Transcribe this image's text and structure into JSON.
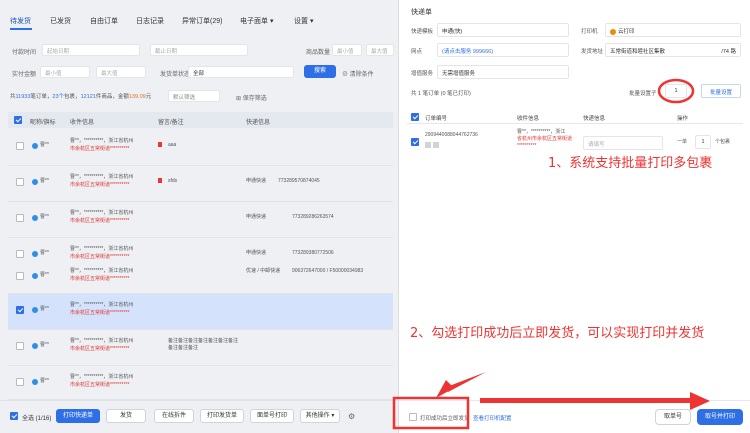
{
  "tabs": [
    "待发货",
    "已发货",
    "自由订单",
    "日志记录",
    "异常订单(29)",
    "电子面单 ▾",
    "设置 ▾"
  ],
  "filters": {
    "row1": [
      {
        "label": "付款时间",
        "ph": "起始日期"
      },
      {
        "label": "",
        "ph": "截止日期"
      },
      {
        "label": "商品数量",
        "ph": "最小值"
      },
      {
        "label": "",
        "ph": "最大值"
      }
    ],
    "row2": [
      {
        "label": "实付金额",
        "ph": "最小值"
      },
      {
        "label": "",
        "ph": "最大值"
      },
      {
        "label": "发货单状态",
        "ph": "全部"
      }
    ],
    "search": "搜索",
    "clear": "⊘ 清除条件"
  },
  "summary": {
    "prefix": "共",
    "orders": "11933",
    "t1": "笔订单，",
    "packages": "23个",
    "t2": "包裹，",
    "items": "12121",
    "t3": "件商品，金额",
    "amount": "139.09",
    "unit": "元",
    "tag": "默认筛选",
    "save": "保存筛选"
  },
  "table": {
    "headers": [
      "昵称/旗标",
      "收件信息",
      "留言/备注",
      "快递信息"
    ]
  },
  "rows": [
    {
      "nick": "曹**",
      "addr1": "曹**，**********，浙江省杭州",
      "addr2": "市余杭区五常街道**********",
      "note": "aaa",
      "express": "",
      "tracking": ""
    },
    {
      "nick": "曹**",
      "addr1": "曹**，**********，浙江省杭州",
      "addr2": "市余杭区五常街道**********",
      "note": "sfds",
      "express": "申通快递",
      "tracking": "773289570874045"
    },
    {
      "nick": "曹**",
      "addr1": "曹**，**********，浙江省杭州",
      "addr2": "市余杭区五常街道**********",
      "note": "",
      "express": "申通快递",
      "tracking": "773289286263574"
    },
    {
      "nick": "曹**",
      "addr1": "曹**，**********，浙江省杭州",
      "addr2": "市余杭区五常街道**********",
      "note": "",
      "express": "申通快递",
      "tracking": "773289380772506"
    },
    {
      "nick": "曹**",
      "addr1": "曹**，**********，浙江省杭州",
      "addr2": "市余杭区五常街道**********",
      "note": "",
      "express": "优速 / 中邮快递",
      "tracking": "906372647000 / F50000034983"
    },
    {
      "nick": "曹**",
      "addr1": "曹**，**********，浙江省杭州",
      "addr2": "市余杭区五常街道**********",
      "note": "",
      "express": "",
      "tracking": ""
    },
    {
      "nick": "曹**",
      "addr1": "曹**，**********，浙江省杭州",
      "addr2": "市余杭区五常街道**********",
      "note": "备注备注备注备注备注备注备注备注备注备注",
      "express": "",
      "tracking": ""
    },
    {
      "nick": "曹**",
      "addr1": "曹**，**********，浙江省杭州",
      "addr2": "市余杭区五常街道**********",
      "note": "",
      "express": "",
      "tracking": ""
    }
  ],
  "bottom": {
    "selectall": "全选 (1/16)",
    "buttons": [
      "打印快递单",
      "发货",
      "在线拆件",
      "打印发货单",
      "面单号打印",
      "其他操作 ▾"
    ]
  },
  "panel": {
    "title": "快递单",
    "r1": {
      "l1": "快递模板",
      "v1": "申通(快)",
      "l2": "打印机",
      "v2": "云打印"
    },
    "r2": {
      "l1": "网点",
      "v1": "(请点击服务 999666)",
      "l2": "发货地址",
      "v2": "五常街道和睦社区集散",
      "v2b": "/74 路"
    },
    "r3": {
      "l1": "增值服务",
      "v1": "无需增值服务"
    },
    "batch": {
      "count": "共 1 笔订单 (0 笔已打印)",
      "label": "批量设置子",
      "value": "1",
      "link": "批量设置"
    },
    "headers": [
      "订单编号",
      "收件信息",
      "快递信息",
      "操作"
    ],
    "order": {
      "id": "2909440088044762736",
      "addr1": "曹**，**********，浙江",
      "addr2": "省杭州市余杭区五常街道",
      "addr3": "**********",
      "ph": "请填写",
      "unit": "个包裹",
      "qty": "1",
      "minus": "一单"
    },
    "footer": {
      "checkbox": "打印成功后立即发货",
      "link": "查看打印机配置",
      "b1": "取单号",
      "b2": "取号并打印"
    }
  },
  "annotations": {
    "a1": "1、系统支持批量打印多包裹",
    "a2": "2、勾选打印成功后立即发货，可以实现打印并发货"
  }
}
